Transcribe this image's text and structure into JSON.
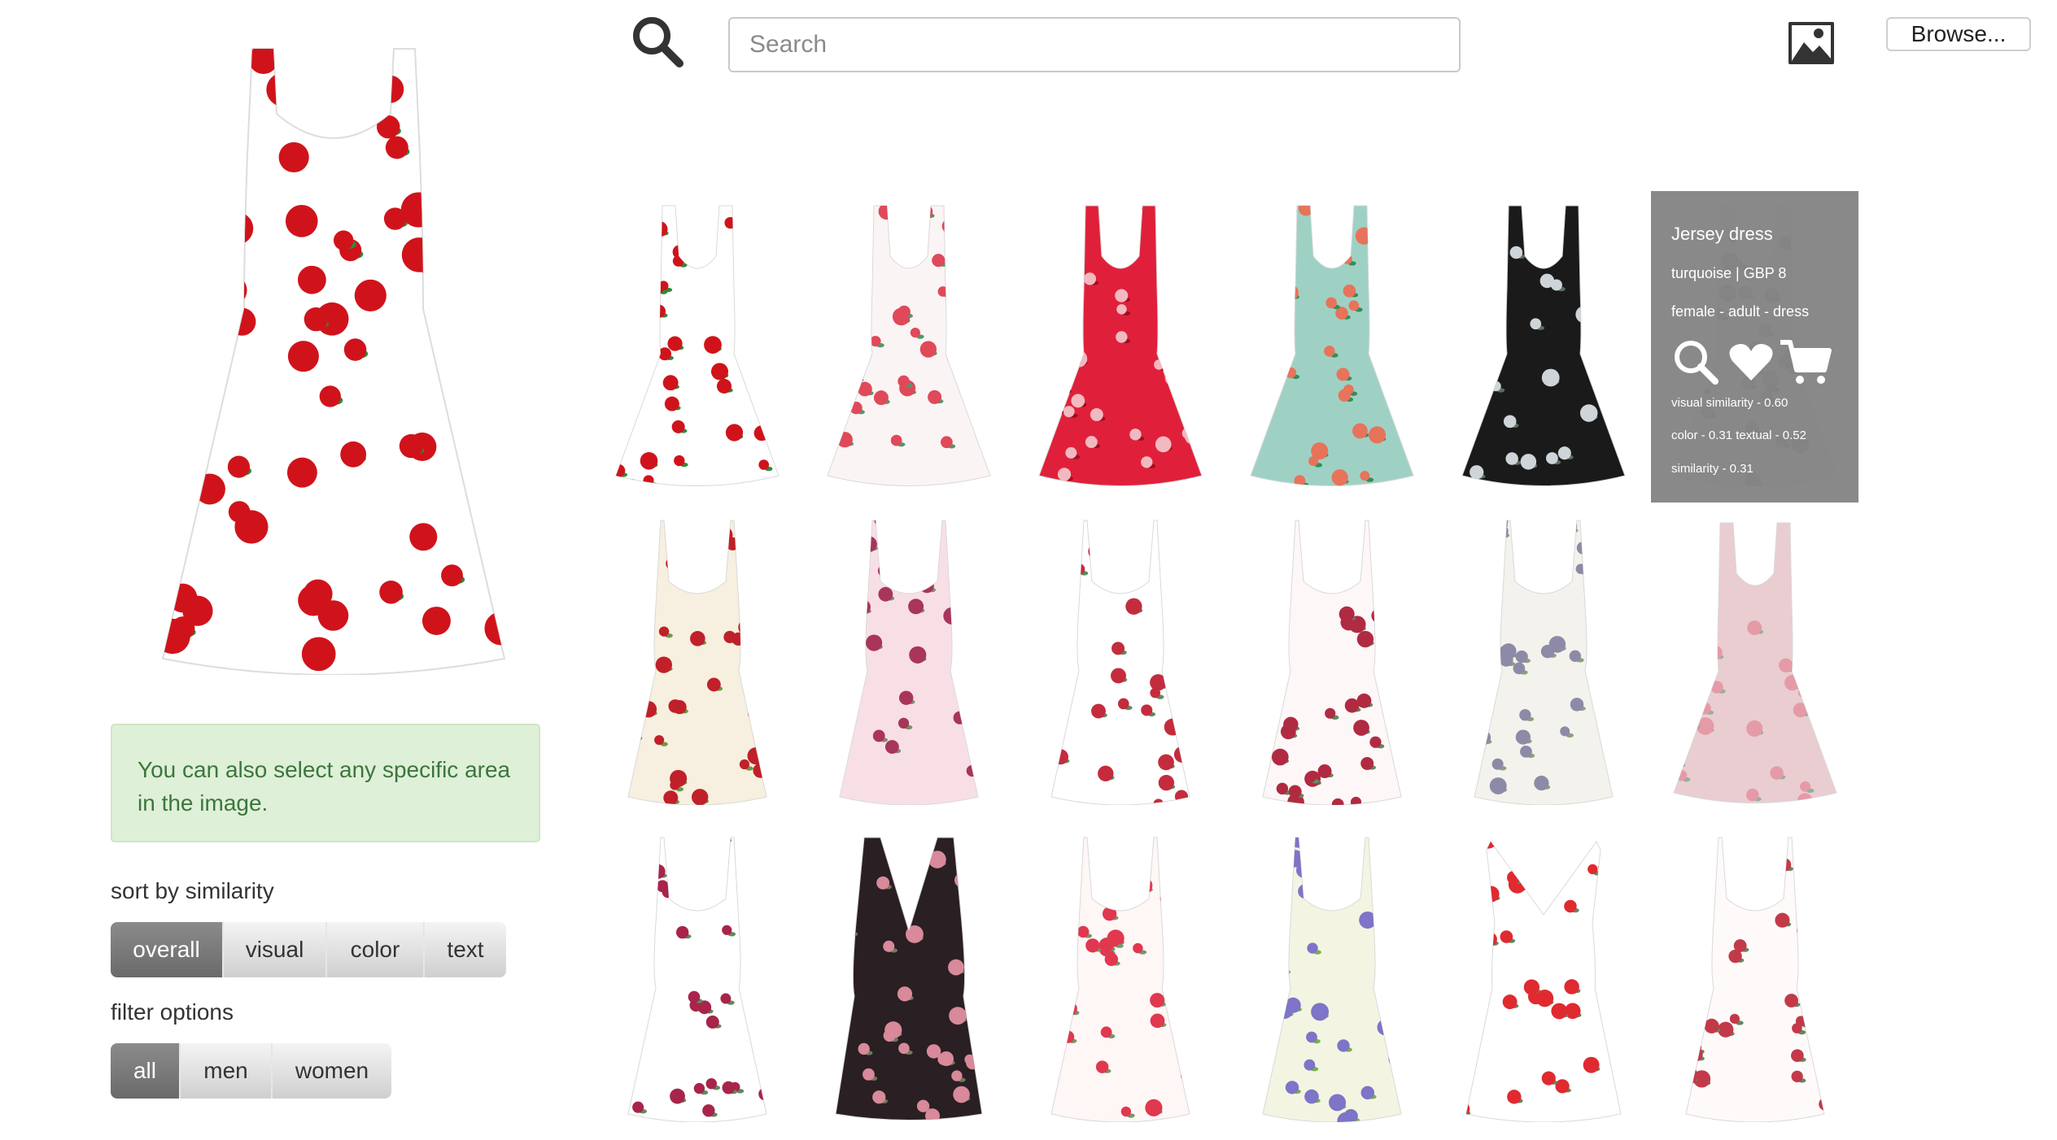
{
  "search": {
    "placeholder": "Search"
  },
  "header": {
    "browse_label": "Browse..."
  },
  "hint": {
    "text": "You can also select any specific area in the image."
  },
  "sort": {
    "label": "sort by similarity",
    "options": [
      "overall",
      "visual",
      "color",
      "text"
    ],
    "selected": "overall"
  },
  "filter": {
    "label": "filter options",
    "options": [
      "all",
      "men",
      "women"
    ],
    "selected": "all"
  },
  "hover_card": {
    "title": "Jersey dress",
    "color_price": "turquoise | GBP 8",
    "tags": "female - adult - dress",
    "visual_similarity": "visual similarity - 0.60",
    "color_textual": "color - 0.31 textual - 0.52",
    "similarity": "similarity - 0.31"
  },
  "colors": {
    "hint_bg": "#dff0d8",
    "hint_text": "#3c763d",
    "active_button": "#7a7a7a",
    "overlay": "#808080"
  },
  "products": [
    {
      "style": "skater",
      "bg": "#ffffff",
      "flower": "#d0131b",
      "leaf": "#2e8b3a"
    },
    {
      "style": "skater",
      "bg": "#fbf4f4",
      "flower": "#e0495a",
      "leaf": "#4f9a6a"
    },
    {
      "style": "skater",
      "bg": "#e0203a",
      "flower": "#f2b9c0",
      "leaf": "#9e0f22"
    },
    {
      "style": "skater",
      "bg": "#9ed1c4",
      "flower": "#e8735b",
      "leaf": "#2f8f56"
    },
    {
      "style": "skater",
      "bg": "#1a1a1a",
      "flower": "#cfd4d8",
      "leaf": "#5a6f5a"
    },
    {
      "style": "skater",
      "bg": "#e8e8e8",
      "flower": "#b8b8b8",
      "leaf": "#9a9a9a"
    },
    {
      "style": "cami",
      "bg": "#f7efdf",
      "flower": "#c0202a",
      "leaf": "#6a9a4a"
    },
    {
      "style": "cami",
      "bg": "#f8dfe6",
      "flower": "#a8355a",
      "leaf": "#7b8f6a"
    },
    {
      "style": "cami",
      "bg": "#ffffff",
      "flower": "#c42c3e",
      "leaf": "#5c8c5c"
    },
    {
      "style": "cami",
      "bg": "#fdf7f7",
      "flower": "#b02b42",
      "leaf": "#5e8a5e"
    },
    {
      "style": "cami",
      "bg": "#f4f2ec",
      "flower": "#8d8aa8",
      "leaf": "#8aa37a"
    },
    {
      "style": "skater",
      "bg": "#e9cdd0",
      "flower": "#e59aa8",
      "leaf": "#8fb19a"
    },
    {
      "style": "cami",
      "bg": "#ffffff",
      "flower": "#a8244a",
      "leaf": "#5e8a5e"
    },
    {
      "style": "vneck",
      "bg": "#2a1f22",
      "flower": "#d8899a",
      "leaf": "#6d7a5a"
    },
    {
      "style": "cami",
      "bg": "#fff6f6",
      "flower": "#e0384e",
      "leaf": "#6f9a6a"
    },
    {
      "style": "cami",
      "bg": "#f3f5e2",
      "flower": "#7e74c8",
      "leaf": "#79b04a"
    },
    {
      "style": "halter",
      "bg": "#ffffff",
      "flower": "#e02a30",
      "leaf": "#5e8a5e"
    },
    {
      "style": "cami",
      "bg": "#fffafa",
      "flower": "#c23a4a",
      "leaf": "#5e8a5e"
    }
  ]
}
